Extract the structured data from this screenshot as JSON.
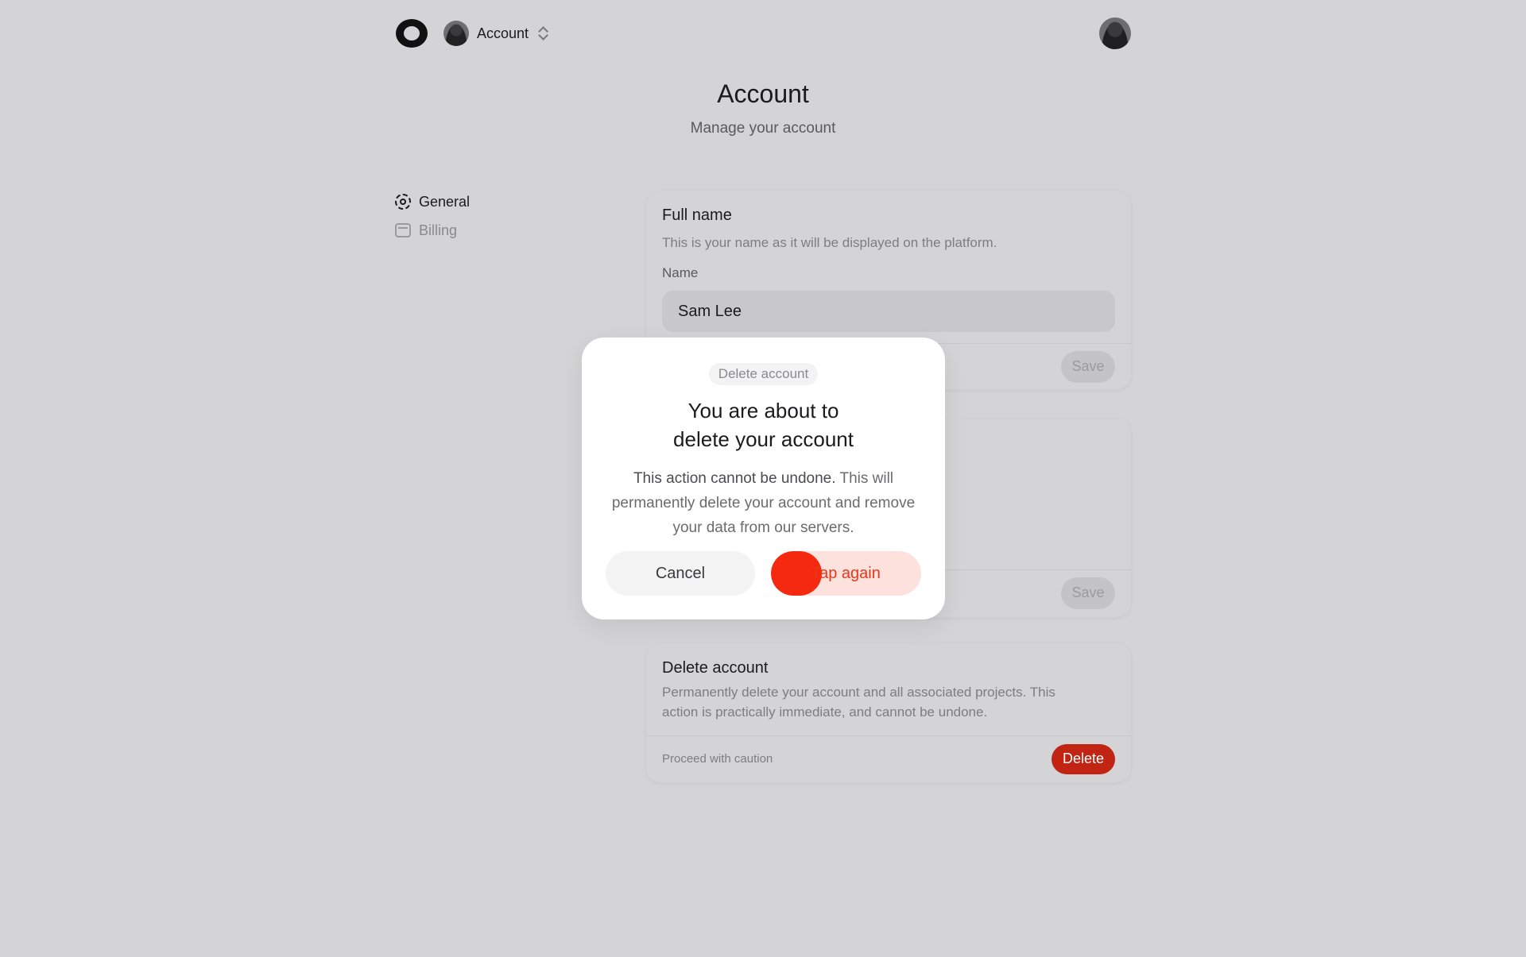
{
  "topbar": {
    "workspace_label": "Account"
  },
  "header": {
    "title": "Account",
    "subtitle": "Manage your account"
  },
  "sidebar": {
    "items": [
      {
        "label": "General",
        "icon": "gear-icon",
        "active": true
      },
      {
        "label": "Billing",
        "icon": "wallet-icon",
        "active": false
      }
    ]
  },
  "full_name_card": {
    "title": "Full name",
    "description": "This is your name as it will be displayed on the platform.",
    "field_label": "Name",
    "field_value": "Sam Lee",
    "save_label": "Save"
  },
  "second_card": {
    "save_label": "Save"
  },
  "delete_card": {
    "title": "Delete account",
    "description": "Permanently delete your account and all associated projects. This action is practically immediate, and cannot be undone.",
    "foot_note": "Proceed with caution",
    "delete_label": "Delete"
  },
  "modal": {
    "tag": "Delete account",
    "title_line1": "You are about to",
    "title_line2": "delete your account",
    "text_strong": "This action cannot be undone.",
    "text_rest": " This will permanently delete your account and remove your data from our servers.",
    "cancel_label": "Cancel",
    "confirm_label": "Tap again",
    "confirm_progress": 0.34
  },
  "colors": {
    "background": "#d4d4d6",
    "danger": "#c22413",
    "confirm_fill": "#f5290f",
    "confirm_bg": "#fde1dc"
  }
}
